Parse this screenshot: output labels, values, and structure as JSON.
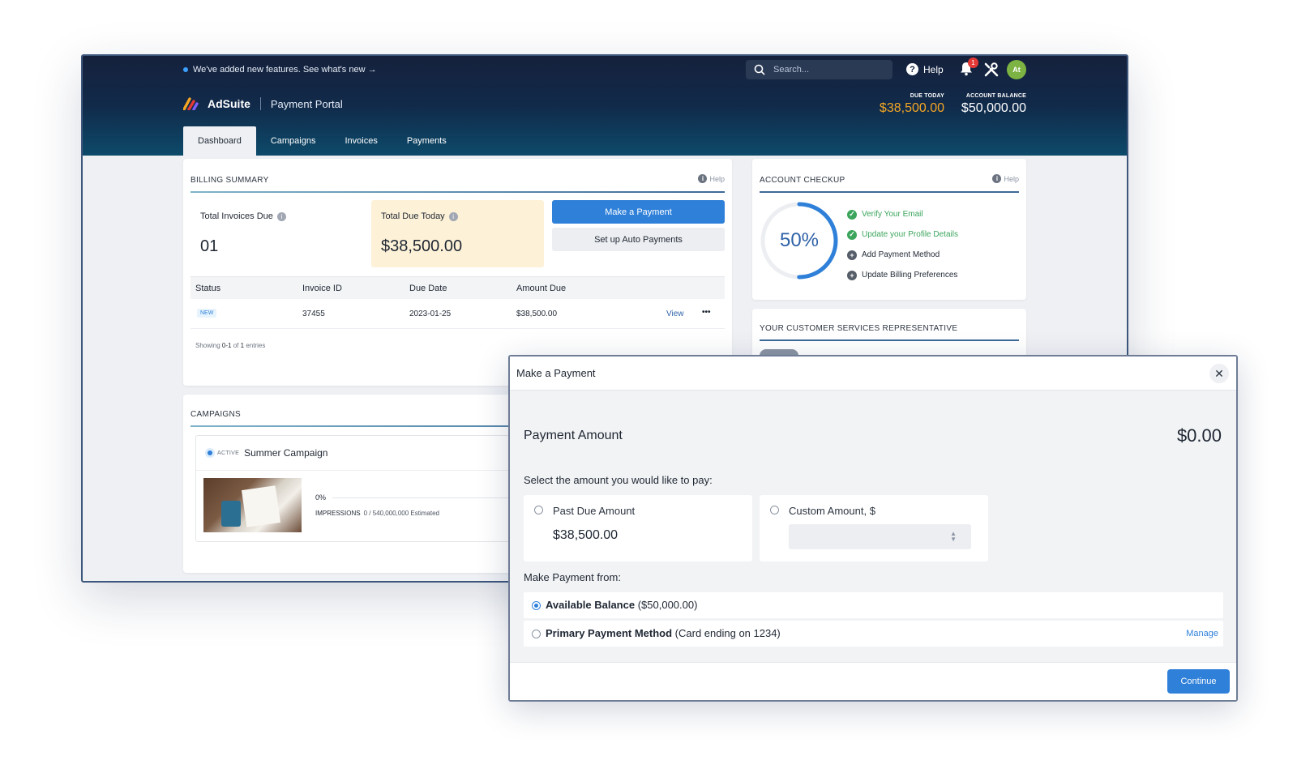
{
  "announcement": "We've added new features. See what's new →",
  "search": {
    "placeholder": "Search..."
  },
  "help_label": "Help",
  "notifications_count": "1",
  "avatar_initials": "At",
  "brand": {
    "name": "AdSuite",
    "portal": "Payment Portal"
  },
  "due_today": {
    "label": "DUE TODAY",
    "value": "$38,500.00"
  },
  "account_balance": {
    "label": "ACCOUNT BALANCE",
    "value": "$50,000.00"
  },
  "tabs": [
    {
      "label": "Dashboard"
    },
    {
      "label": "Campaigns"
    },
    {
      "label": "Invoices"
    },
    {
      "label": "Payments"
    }
  ],
  "billing": {
    "title": "BILLING SUMMARY",
    "help": "Help",
    "total_invoices_label": "Total Invoices Due",
    "total_invoices_value": "01",
    "total_due_label": "Total Due Today",
    "total_due_value": "$38,500.00",
    "make_payment": "Make a Payment",
    "auto_payments": "Set up Auto Payments",
    "columns": [
      "Status",
      "Invoice ID",
      "Due Date",
      "Amount Due"
    ],
    "rows": [
      {
        "status": "NEW",
        "invoice_id": "37455",
        "due_date": "2023-01-25",
        "amount": "$38,500.00",
        "view": "View",
        "more": "•••"
      }
    ],
    "showing_prefix": "Showing",
    "showing_range": "0-1",
    "showing_of": "of",
    "showing_total": "1",
    "showing_suffix": "entries"
  },
  "checkup": {
    "title": "ACCOUNT CHECKUP",
    "help": "Help",
    "percent": "50%",
    "progress": 0.5,
    "items": [
      {
        "label": "Verify Your Email",
        "done": true
      },
      {
        "label": "Update your Profile Details",
        "done": true
      },
      {
        "label": "Add Payment Method",
        "done": false
      },
      {
        "label": "Update Billing Preferences",
        "done": false
      }
    ]
  },
  "rep": {
    "title": "YOUR CUSTOMER SERVICES REPRESENTATIVE"
  },
  "campaigns": {
    "title": "CAMPAIGNS",
    "item": {
      "status": "ACTIVE",
      "name": "Summer Campaign",
      "progress": "0%",
      "impressions_label": "IMPRESSIONS",
      "impressions_value": "0 / 540,000,000 Estimated"
    }
  },
  "modal": {
    "title": "Make a Payment",
    "amount_label": "Payment Amount",
    "amount_value": "$0.00",
    "select_label": "Select the amount you would like to pay:",
    "past_due_label": "Past Due Amount",
    "past_due_value": "$38,500.00",
    "custom_label": "Custom Amount, $",
    "from_label": "Make Payment from:",
    "source1_bold": "Available Balance",
    "source1_rest": "($50,000.00)",
    "source2_bold": "Primary Payment Method",
    "source2_rest": "(Card ending on 1234)",
    "manage": "Manage",
    "continue": "Continue"
  },
  "colors": {
    "accent": "#2f80d9",
    "due": "#f5a623",
    "success": "#3ba55c",
    "header": "#112a4a"
  }
}
